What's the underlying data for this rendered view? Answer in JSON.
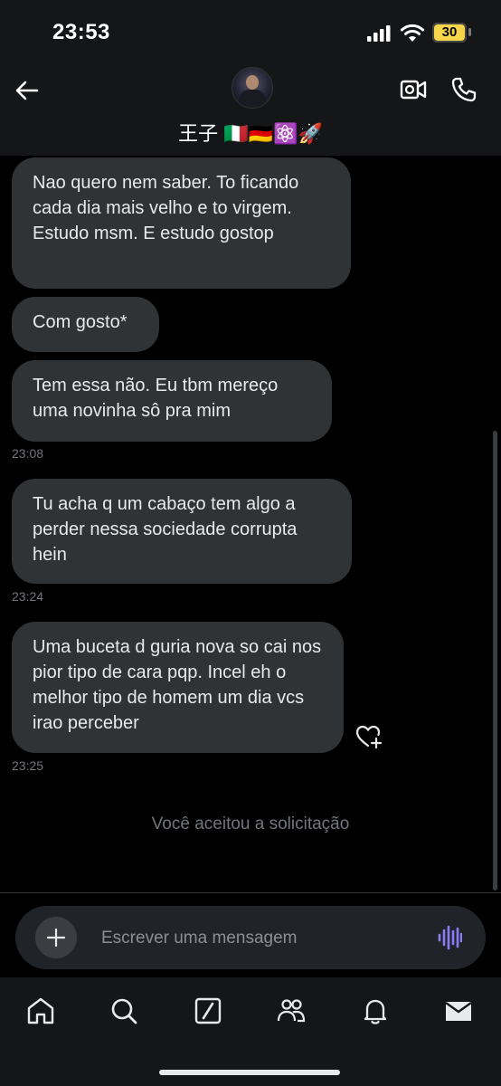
{
  "status_bar": {
    "time": "23:53",
    "battery": "30"
  },
  "header": {
    "contact_name": "王子 🇮🇹🇩🇪⚛️🚀"
  },
  "messages": [
    {
      "text": "Nao quero nem saber. To ficando cada dia mais velho e to virgem. Estudo msm. E estudo gostop",
      "time": ""
    },
    {
      "text": "Com gosto*",
      "time": ""
    },
    {
      "text": "Tem essa não. Eu tbm mereço uma novinha sô pra mim",
      "time": "23:08"
    },
    {
      "text": "Tu acha q um cabaço tem algo a perder nessa sociedade corrupta hein",
      "time": "23:24"
    },
    {
      "text": "Uma buceta d guria nova so cai nos pior tipo de cara pqp. Incel eh o melhor tipo de homem um dia vcs irao perceber",
      "time": "23:25"
    }
  ],
  "system_message": "Você aceitou a solicitação",
  "composer": {
    "placeholder": "Escrever uma mensagem"
  },
  "tabs": [
    {
      "icon": "home-icon"
    },
    {
      "icon": "search-icon"
    },
    {
      "icon": "grok-icon"
    },
    {
      "icon": "communities-icon"
    },
    {
      "icon": "notifications-icon"
    },
    {
      "icon": "messages-icon"
    }
  ],
  "colors": {
    "accent": "#8b7cf6",
    "bubble": "#2f3336",
    "background": "#000000",
    "muted": "#71767b"
  }
}
